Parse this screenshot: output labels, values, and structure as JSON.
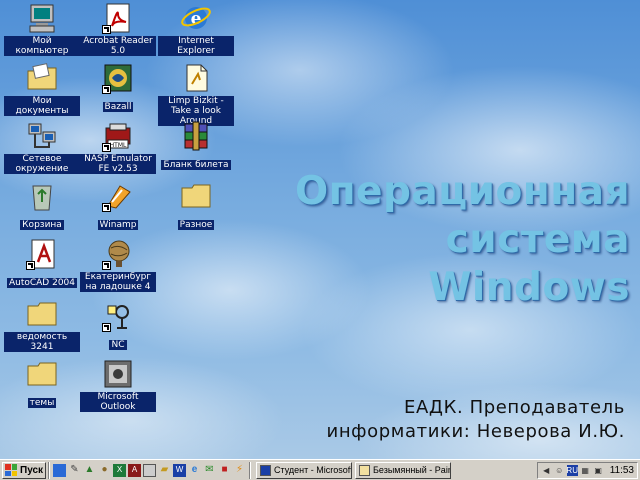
{
  "desktop": {
    "title_line1": "Операционная",
    "title_line2": "система Windows",
    "subtitle_line1": "ЕАДК. Преподаватель",
    "subtitle_line2": "информатики: Неверова И.Ю.",
    "icons": [
      {
        "label": "Мой компьютер",
        "icon": "my-computer-icon"
      },
      {
        "label": "Acrobat Reader 5.0",
        "icon": "acrobat-icon"
      },
      {
        "label": "Internet Explorer",
        "icon": "internet-explorer-icon"
      },
      {
        "label": "Мои документы",
        "icon": "my-documents-icon"
      },
      {
        "label": "Bazall",
        "icon": "bazall-icon"
      },
      {
        "label": "Limp Bizkit - Take a look Around",
        "icon": "document-icon"
      },
      {
        "label": "Сетевое окружение",
        "icon": "network-icon"
      },
      {
        "label": "NASP Emulator FE v2.53",
        "icon": "winrar-icon"
      },
      {
        "label": "Бланк билета",
        "icon": "winrar-archive-icon"
      },
      {
        "label": "Корзина",
        "icon": "recycle-bin-icon"
      },
      {
        "label": "Winamp",
        "icon": "winamp-icon"
      },
      {
        "label": "Разное",
        "icon": "folder-icon"
      },
      {
        "label": "AutoCAD 2004",
        "icon": "autocad-icon"
      },
      {
        "label": "Екатеринбург на ладошке 4",
        "icon": "globe-icon"
      },
      {
        "label": "ведомость 3241",
        "icon": "folder-icon"
      },
      {
        "label": "NC",
        "icon": "nc-icon"
      },
      {
        "label": "темы",
        "icon": "folder-icon"
      },
      {
        "label": "Microsoft Outlook",
        "icon": "outlook-icon"
      }
    ]
  },
  "taskbar": {
    "start_label": "Пуск",
    "tasks": [
      {
        "label": "Студент - Microsoft ...",
        "icon": "word-icon"
      },
      {
        "label": "Безымянный - Paint",
        "icon": "paint-icon"
      }
    ],
    "tray_lang": "RU",
    "clock": "11:53"
  },
  "colors": {
    "label_bg": "#0a246a",
    "title": "#74c3e4",
    "taskbar": "#d4d0c8"
  }
}
